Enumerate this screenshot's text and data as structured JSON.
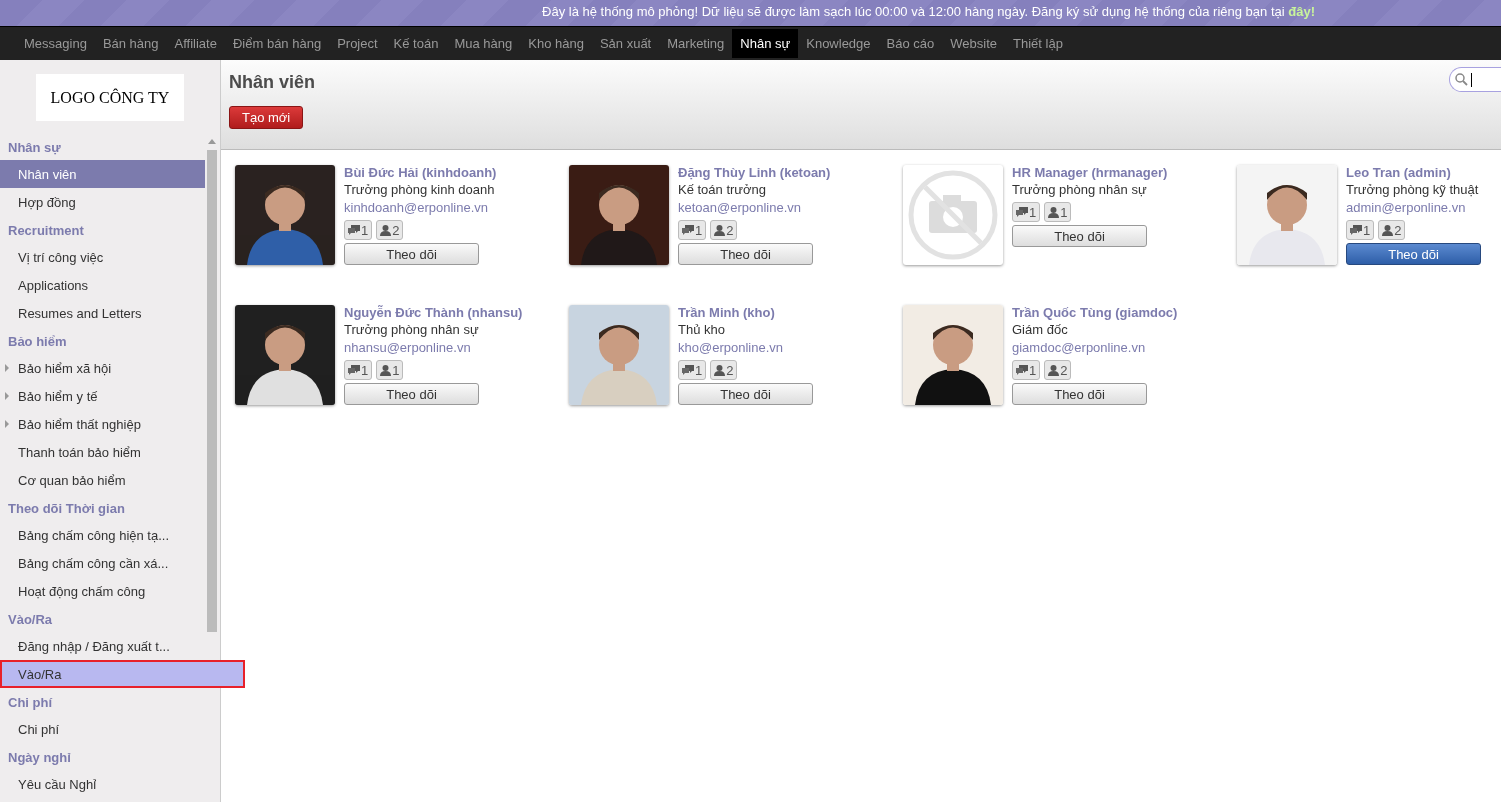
{
  "banner": {
    "text": "Đây là hệ thống mô phỏng! Dữ liệu sẽ được làm sạch lúc 00:00 và 12:00 hàng ngày. Đăng ký sử dụng hệ thống của riêng bạn tại ",
    "link": "đây!"
  },
  "menu": [
    {
      "label": "Messaging",
      "selected": false
    },
    {
      "label": "Bán hàng",
      "selected": false
    },
    {
      "label": "Affiliate",
      "selected": false
    },
    {
      "label": "Điểm bán hàng",
      "selected": false
    },
    {
      "label": "Project",
      "selected": false
    },
    {
      "label": "Kế toán",
      "selected": false
    },
    {
      "label": "Mua hàng",
      "selected": false
    },
    {
      "label": "Kho hàng",
      "selected": false
    },
    {
      "label": "Sản xuất",
      "selected": false
    },
    {
      "label": "Marketing",
      "selected": false
    },
    {
      "label": "Nhân sự",
      "selected": true
    },
    {
      "label": "Knowledge",
      "selected": false
    },
    {
      "label": "Báo cáo",
      "selected": false
    },
    {
      "label": "Website",
      "selected": false
    },
    {
      "label": "Thiết lập",
      "selected": false
    }
  ],
  "logo": "LOGO CÔNG TY",
  "sidebar": {
    "sections": [
      {
        "title": "Nhân sự",
        "items": [
          {
            "label": "Nhân viên",
            "kind": "leaf",
            "selected": true,
            "hovered": false
          },
          {
            "label": "Hợp đồng",
            "kind": "leaf",
            "selected": false,
            "hovered": false
          }
        ]
      },
      {
        "title": "Recruitment",
        "items": [
          {
            "label": "Vị trí công việc",
            "kind": "leaf",
            "selected": false,
            "hovered": false
          },
          {
            "label": "Applications",
            "kind": "leaf",
            "selected": false,
            "hovered": false
          },
          {
            "label": "Resumes and Letters",
            "kind": "leaf",
            "selected": false,
            "hovered": false
          }
        ]
      },
      {
        "title": "Bảo hiểm",
        "items": [
          {
            "label": "Bảo hiểm xã hội",
            "kind": "folder",
            "selected": false,
            "hovered": false
          },
          {
            "label": "Bảo hiểm y tế",
            "kind": "folder",
            "selected": false,
            "hovered": false
          },
          {
            "label": "Bảo hiểm thất nghiệp",
            "kind": "folder",
            "selected": false,
            "hovered": false
          },
          {
            "label": "Thanh toán bảo hiểm",
            "kind": "leaf",
            "selected": false,
            "hovered": false
          },
          {
            "label": "Cơ quan bảo hiểm",
            "kind": "leaf",
            "selected": false,
            "hovered": false
          }
        ]
      },
      {
        "title": "Theo dõi Thời gian",
        "items": [
          {
            "label": "Bảng chấm công hiện tạ...",
            "kind": "leaf",
            "selected": false,
            "hovered": false
          },
          {
            "label": "Bảng chấm công cần xá...",
            "kind": "leaf",
            "selected": false,
            "hovered": false
          },
          {
            "label": "Hoạt động chấm công",
            "kind": "leaf",
            "selected": false,
            "hovered": false
          }
        ]
      },
      {
        "title": "Vào/Ra",
        "items": [
          {
            "label": "Đăng nhập / Đăng xuất t...",
            "kind": "leaf",
            "selected": false,
            "hovered": false
          },
          {
            "label": "Vào/Ra",
            "kind": "leaf",
            "selected": false,
            "hovered": true
          }
        ]
      },
      {
        "title": "Chi phí",
        "items": [
          {
            "label": "Chi phí",
            "kind": "leaf",
            "selected": false,
            "hovered": false
          }
        ]
      },
      {
        "title": "Ngày nghỉ",
        "items": [
          {
            "label": "Yêu cầu Nghỉ",
            "kind": "leaf",
            "selected": false,
            "hovered": false
          }
        ]
      }
    ]
  },
  "page": {
    "title": "Nhân viên",
    "create_button": "Tạo mới"
  },
  "employees": [
    {
      "name": "Bùi Đức Hải (kinhdoanh)",
      "job": "Trưởng phòng kinh doanh",
      "email": "kinhdoanh@erponline.vn",
      "messages": "1",
      "followers": "2",
      "follow_button": "Theo dõi",
      "highlighted": false
    },
    {
      "name": "Đặng Thùy Linh (ketoan)",
      "job": "Kế toán trưởng",
      "email": "ketoan@erponline.vn",
      "messages": "1",
      "followers": "2",
      "follow_button": "Theo dõi",
      "highlighted": false
    },
    {
      "name": "HR Manager (hrmanager)",
      "job": "Trưởng phòng nhân sự",
      "messages": "1",
      "followers": "1",
      "follow_button": "Theo dõi",
      "highlighted": false,
      "photo": {
        "kind": "placeholder"
      }
    },
    {
      "name": "Leo Tran (admin)",
      "job": "Trưởng phòng kỹ thuật",
      "email": "admin@erponline.vn",
      "messages": "1",
      "followers": "2",
      "follow_button": "Theo dõi",
      "highlighted": true
    },
    {
      "name": "Nguyễn Đức Thành (nhansu)",
      "job": "Trưởng phòng nhân sự",
      "email": "nhansu@erponline.vn",
      "messages": "1",
      "followers": "1",
      "follow_button": "Theo dõi",
      "highlighted": false
    },
    {
      "name": "Trần Minh (kho)",
      "job": "Thủ kho",
      "email": "kho@erponline.vn",
      "messages": "1",
      "followers": "2",
      "follow_button": "Theo dõi",
      "highlighted": false
    },
    {
      "name": "Trần Quốc Tùng (giamdoc)",
      "job": "Giám đốc",
      "email": "giamdoc@erponline.vn",
      "messages": "1",
      "followers": "2",
      "follow_button": "Theo dõi",
      "highlighted": false
    }
  ]
}
